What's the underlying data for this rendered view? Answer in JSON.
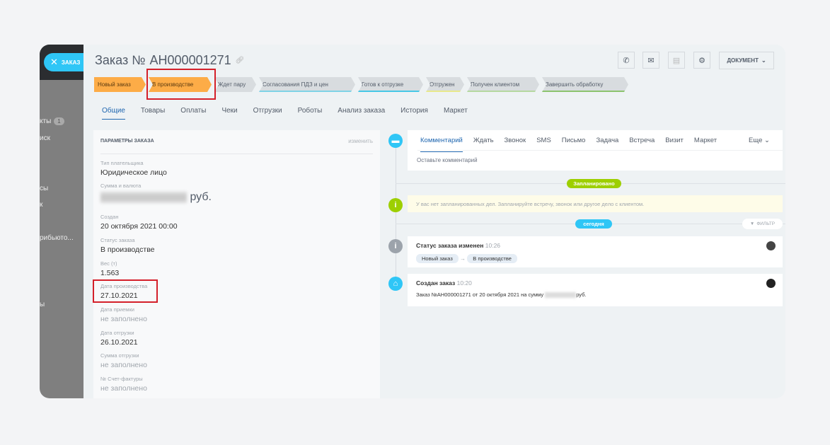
{
  "sidebar": {
    "close_label": "ЗАКАЗ",
    "items": [
      {
        "label": "кты",
        "badge": "1"
      },
      {
        "label": "иск"
      },
      {
        "label": "сы"
      },
      {
        "label": "к"
      },
      {
        "label": "рибьюто..."
      },
      {
        "label": "ы"
      }
    ]
  },
  "header": {
    "title_prefix": "Заказ №",
    "order_number": "АН000001271",
    "document_label": "ДОКУМЕНТ",
    "icons": [
      "phone-icon",
      "mail-icon",
      "chat-icon",
      "gear-icon"
    ]
  },
  "stages": [
    {
      "label": "Новый заказ",
      "active": true
    },
    {
      "label": "В производстве",
      "active": true
    },
    {
      "label": "Ждет пару",
      "active": false,
      "color": "#d8dcdf"
    },
    {
      "label": "Согласования ПДЗ и цен",
      "active": false,
      "color": "#7fd3e6"
    },
    {
      "label": "Готов к отгрузке",
      "active": false,
      "color": "#47c8e6"
    },
    {
      "label": "Отгружен",
      "active": false,
      "color": "#e8e98c"
    },
    {
      "label": "Получен клиентом",
      "active": false,
      "color": "#b5d9a0"
    },
    {
      "label": "Завершить обработку",
      "active": false,
      "color": "#8cc46e"
    }
  ],
  "tabs": [
    "Общие",
    "Товары",
    "Оплаты",
    "Чеки",
    "Отгрузки",
    "Роботы",
    "Анализ заказа",
    "История",
    "Маркет"
  ],
  "params": {
    "title": "ПАРАМЕТРЫ ЗАКАЗА",
    "edit_label": "изменить",
    "fields": [
      {
        "label": "Тип плательщика",
        "value": "Юридическое лицо"
      },
      {
        "label": "Сумма и валюта",
        "value": "руб."
      },
      {
        "label": "Создан",
        "value": "20 октября 2021 00:00"
      },
      {
        "label": "Статус заказа",
        "value": "В производстве"
      },
      {
        "label": "Вес (т)",
        "value": "1.563"
      },
      {
        "label": "Дата производства",
        "value": "27.10.2021"
      },
      {
        "label": "Дата приемки",
        "value": "не заполнено"
      },
      {
        "label": "Дата отгрузки",
        "value": "26.10.2021"
      },
      {
        "label": "Сумма отгрузки",
        "value": "не заполнено"
      },
      {
        "label": "№ Счет-фактуры",
        "value": "не заполнено"
      }
    ]
  },
  "timeline": {
    "tabs": [
      "Комментарий",
      "Ждать",
      "Звонок",
      "SMS",
      "Письмо",
      "Задача",
      "Встреча",
      "Визит",
      "Маркет"
    ],
    "more_label": "Еще",
    "comment_placeholder": "Оставьте комментарий",
    "planned_label": "Запланировано",
    "no_planned_text": "У вас нет запланированных дел. Запланируйте встречу, звонок или другое дело с клиентом.",
    "today_label": "сегодня",
    "filter_label": "ФИЛЬТР",
    "events": [
      {
        "title": "Статус заказа изменен",
        "time": "10:26",
        "from": "Новый заказ",
        "to": "В производстве"
      },
      {
        "title": "Создан заказ",
        "time": "10:20",
        "text_before": "Заказ №АН000001271 от 20 октября 2021 на сумму",
        "text_after": "руб."
      }
    ]
  },
  "colors": {
    "accent": "#2fc6f6",
    "stage_active": "#fdac47",
    "planned": "#9dcf00",
    "highlight": "#d4202a"
  }
}
